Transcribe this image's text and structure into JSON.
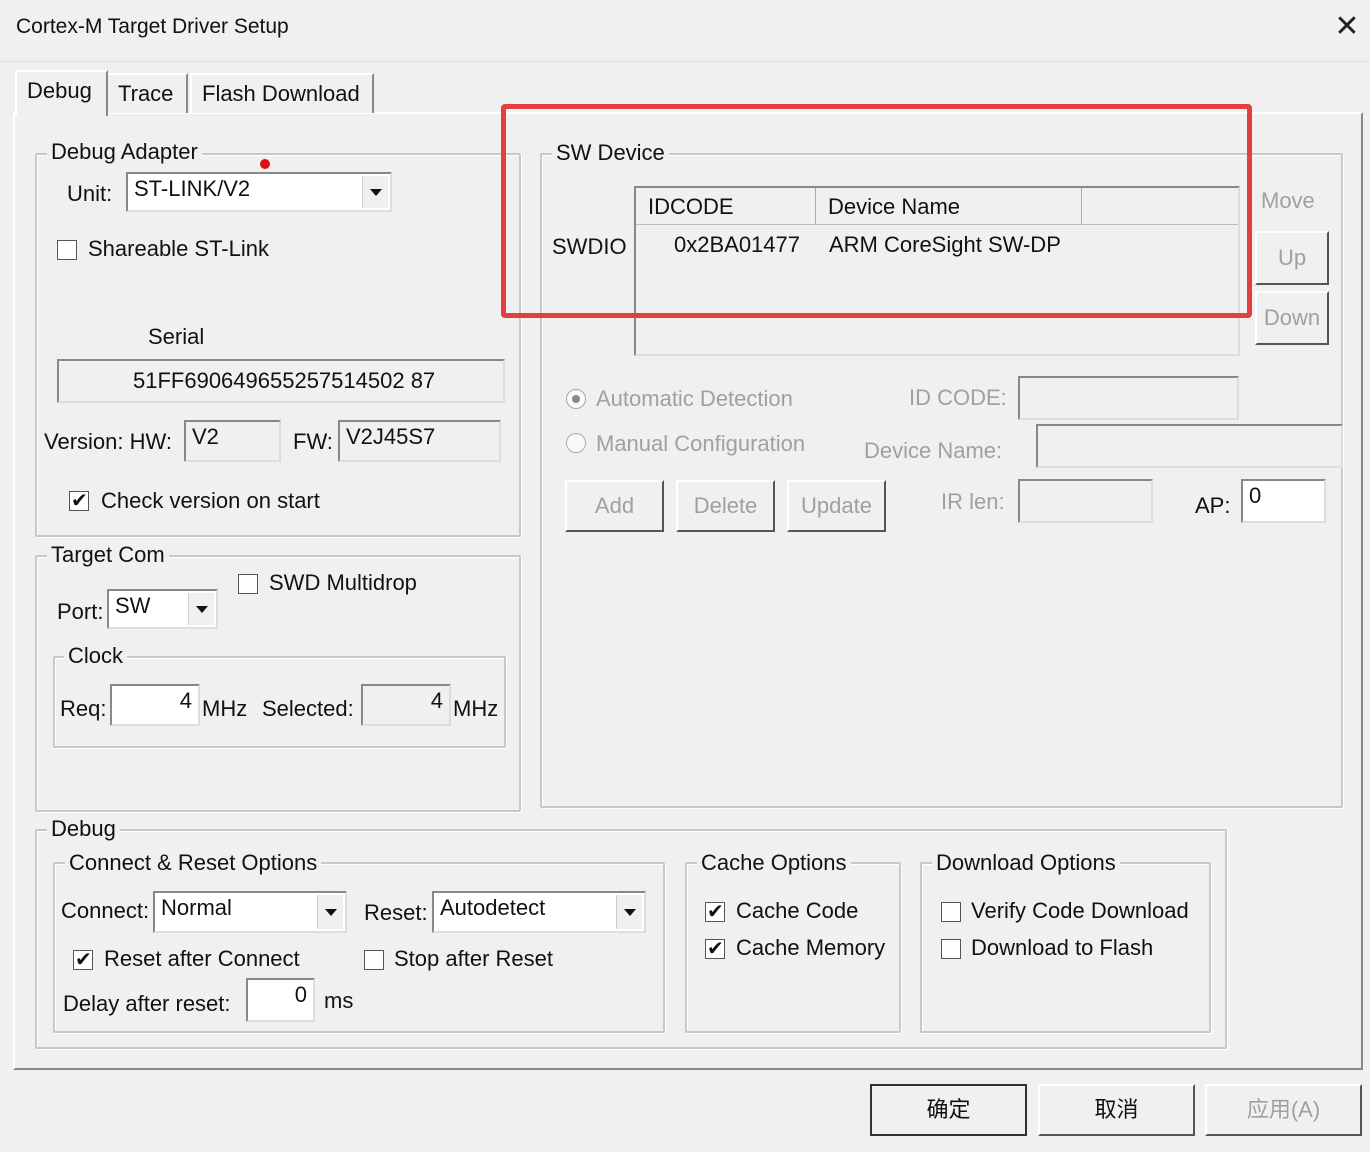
{
  "window": {
    "title": "Cortex-M Target Driver Setup"
  },
  "tabs": [
    {
      "label": "Debug"
    },
    {
      "label": "Trace"
    },
    {
      "label": "Flash Download"
    }
  ],
  "debug_adapter": {
    "legend": "Debug Adapter",
    "unit_label": "Unit:",
    "unit_value": "ST-LINK/V2",
    "shareable_label": "Shareable ST-Link",
    "shareable_checked": false,
    "serial_label": "Serial",
    "serial_value": "51FF690649655257514502 87",
    "version_label": "Version: HW:",
    "hw_value": "V2",
    "fw_label": "FW:",
    "fw_value": "V2J45S7",
    "check_version_label": "Check version on start",
    "check_version_checked": true
  },
  "target_com": {
    "legend": "Target Com",
    "port_label": "Port:",
    "port_value": "SW",
    "swd_multidrop_label": "SWD Multidrop",
    "clock_legend": "Clock",
    "req_label": "Req:",
    "req_value": "4",
    "req_unit": "MHz",
    "selected_label": "Selected:",
    "selected_value": "4",
    "selected_unit": "MHz"
  },
  "sw_device": {
    "legend": "SW Device",
    "columns": [
      "IDCODE",
      "Device Name"
    ],
    "row_label": "SWDIO",
    "rows": [
      {
        "idcode": "0x2BA01477",
        "name": "ARM CoreSight SW-DP"
      }
    ],
    "move_label": "Move",
    "up_label": "Up",
    "down_label": "Down",
    "auto_detect_label": "Automatic Detection",
    "manual_config_label": "Manual Configuration",
    "id_code_label": "ID CODE:",
    "device_name_label": "Device Name:",
    "add_label": "Add",
    "delete_label": "Delete",
    "update_label": "Update",
    "ir_len_label": "IR len:",
    "ap_label": "AP:",
    "ap_value": "0"
  },
  "debug": {
    "legend": "Debug",
    "connect_reset": {
      "legend": "Connect & Reset Options",
      "connect_label": "Connect:",
      "connect_value": "Normal",
      "reset_label": "Reset:",
      "reset_value": "Autodetect",
      "reset_after_connect_label": "Reset after Connect",
      "stop_after_reset_label": "Stop after Reset",
      "delay_label": "Delay after reset:",
      "delay_value": "0",
      "delay_unit": "ms"
    },
    "cache": {
      "legend": "Cache Options",
      "cache_code_label": "Cache Code",
      "cache_memory_label": "Cache Memory"
    },
    "download": {
      "legend": "Download Options",
      "verify_label": "Verify Code Download",
      "download_flash_label": "Download to Flash"
    }
  },
  "footer": {
    "ok_label": "确定",
    "cancel_label": "取消",
    "apply_label": "应用(A)"
  },
  "colors": {
    "annotation": "#e43f3f",
    "disabled_text": "#a0a0a0"
  }
}
